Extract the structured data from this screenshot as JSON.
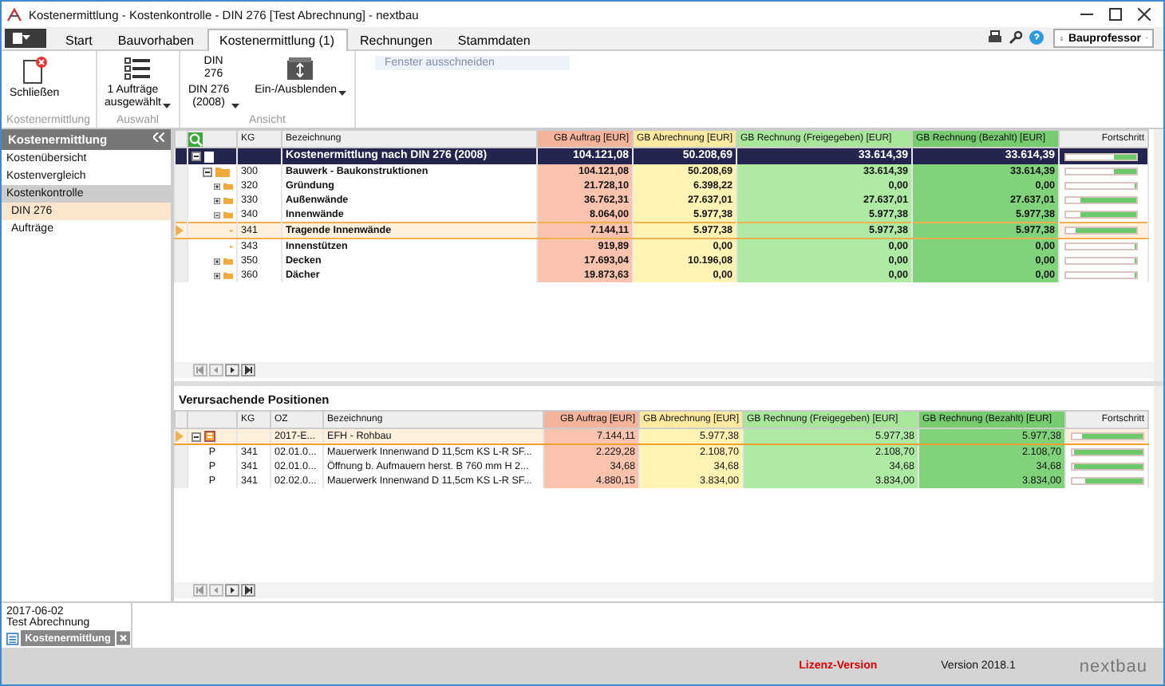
{
  "window": {
    "title": "Kostenermittlung - Kostenkontrolle - DIN 276 [Test Abrechnung] - nextbau"
  },
  "tabs": [
    {
      "label": "Start",
      "selected": false
    },
    {
      "label": "Bauvorhaben",
      "selected": false
    },
    {
      "label": "Kostenermittlung (1)",
      "selected": true
    },
    {
      "label": "Rechnungen",
      "selected": false
    },
    {
      "label": "Stammdaten",
      "selected": false
    }
  ],
  "user": {
    "name": "Bauprofessor"
  },
  "faded_hint": "Fenster ausschneiden",
  "ribbon": [
    {
      "label": "Kostenermittlung",
      "buttons": [
        {
          "kind": "close",
          "label": "Schließen",
          "dropdown": false
        }
      ]
    },
    {
      "label": "Auswahl",
      "buttons": [
        {
          "kind": "list",
          "label": "1 Aufträge\nausgewählt",
          "dropdown": true
        }
      ]
    },
    {
      "label": "Ansicht",
      "buttons": [
        {
          "kind": "text",
          "icon_text": "DIN\n276",
          "label": "DIN 276\n(2008)",
          "dropdown": true
        },
        {
          "kind": "box",
          "label": "Ein-/Ausblenden",
          "dropdown": true
        }
      ]
    }
  ],
  "sidebar": {
    "title": "Kostenermittlung",
    "items": [
      {
        "label": "Kostenübersicht",
        "selected": false
      },
      {
        "label": "Kostenvergleich",
        "selected": false
      },
      {
        "label": "Kostenkontrolle",
        "selected": false,
        "children": [
          {
            "label": "DIN 276",
            "selected": true
          },
          {
            "label": "Aufträge",
            "selected": false
          }
        ]
      }
    ]
  },
  "table": {
    "columns": [
      "KG",
      "Bezeichnung",
      "GB Auftrag [EUR]",
      "GB Abrechnung [EUR]",
      "GB Rechnung (Freigegeben) [EUR]",
      "GB Rechnung (Bezahlt) [EUR]",
      "Fortschritt"
    ],
    "rows": [
      {
        "kg": "",
        "name": "Kostenermittlung nach DIN 276 (2008)",
        "auftrag": "104.121,08",
        "abrechnung": "50.208,69",
        "freigegeben": "33.614,39",
        "bezahlt": "33.614,39",
        "level": 0.3,
        "selected": false,
        "expanded": true,
        "children": [
          {
            "kg": "300",
            "name": "Bauwerk - Baukonstruktionen",
            "auftrag": "104.121,08",
            "abrechnung": "50.208,69",
            "freigegeben": "33.614,39",
            "bezahlt": "33.614,39",
            "level": 0.3,
            "selected": false,
            "expanded": true,
            "children": [
              {
                "kg": "320",
                "name": "Gründung",
                "auftrag": "21.728,10",
                "abrechnung": "6.398,22",
                "freigegeben": "0,00",
                "bezahlt": "0,00",
                "level": 0,
                "selected": false,
                "expanded": false
              },
              {
                "kg": "330",
                "name": "Außenwände",
                "auftrag": "36.762,31",
                "abrechnung": "27.637,01",
                "freigegeben": "27.637,01",
                "bezahlt": "27.637,01",
                "level": 0.78,
                "selected": false,
                "expanded": false
              },
              {
                "kg": "340",
                "name": "Innenwände",
                "auftrag": "8.064,00",
                "abrechnung": "5.977,38",
                "freigegeben": "5.977,38",
                "bezahlt": "5.977,38",
                "level": 0.78,
                "selected": false,
                "expanded": true,
                "children": [
                  {
                    "kg": "341",
                    "name": "Tragende Innenwände",
                    "auftrag": "7.144,11",
                    "abrechnung": "5.977,38",
                    "freigegeben": "5.977,38",
                    "bezahlt": "5.977,38",
                    "level": 0.85,
                    "selected": true
                  },
                  {
                    "kg": "343",
                    "name": "Innenstützen",
                    "auftrag": "919,89",
                    "abrechnung": "0,00",
                    "freigegeben": "0,00",
                    "bezahlt": "0,00",
                    "level": 0,
                    "selected": false
                  }
                ]
              },
              {
                "kg": "350",
                "name": "Decken",
                "auftrag": "17.693,04",
                "abrechnung": "10.196,08",
                "freigegeben": "0,00",
                "bezahlt": "0,00",
                "level": 0,
                "selected": false,
                "expanded": false
              },
              {
                "kg": "360",
                "name": "Dächer",
                "auftrag": "19.873,63",
                "abrechnung": "0,00",
                "freigegeben": "0,00",
                "bezahlt": "0,00",
                "level": 0,
                "selected": false,
                "expanded": false
              }
            ]
          }
        ]
      }
    ]
  },
  "positions": {
    "title": "Verursachende Positionen",
    "columns": [
      "KG",
      "OZ",
      "Bezeichnung",
      "GB Auftrag [EUR]",
      "GB Abrechnung [EUR]",
      "GB Rechnung (Freigegeben) [EUR]",
      "GB Rechnung (Bezahlt) [EUR]",
      "Fortschritt"
    ],
    "rows": [
      {
        "kind": "order",
        "type": "",
        "kg": "",
        "oz": "2017-E...",
        "name": "EFH - Rohbau",
        "auftrag": "7.144,11",
        "abrechnung": "5.977,38",
        "freigegeben": "5.977,38",
        "bezahlt": "5.977,38",
        "level": 0.85,
        "selected": true,
        "expanded": true
      },
      {
        "kind": "position",
        "type": "P",
        "kg": "341",
        "oz": "02.01.0...",
        "name": "Mauerwerk Innenwand D 11,5cm KS L-R SF...",
        "auftrag": "2.229,28",
        "abrechnung": "2.108,70",
        "freigegeben": "2.108,70",
        "bezahlt": "2.108,70",
        "level": 0.95,
        "selected": false
      },
      {
        "kind": "position",
        "type": "P",
        "kg": "341",
        "oz": "02.01.0...",
        "name": "Öffnung b. Aufmauern herst. B 760 mm H 2...",
        "auftrag": "34,68",
        "abrechnung": "34,68",
        "freigegeben": "34,68",
        "bezahlt": "34,68",
        "level": 0.95,
        "selected": false
      },
      {
        "kind": "position",
        "type": "P",
        "kg": "341",
        "oz": "02.02.0...",
        "name": "Mauerwerk Innenwand D 11,5cm KS L-R SF...",
        "auftrag": "4.880,15",
        "abrechnung": "3.834,00",
        "freigegeben": "3.834,00",
        "bezahlt": "3.834,00",
        "level": 0.8,
        "selected": false
      }
    ]
  },
  "task": {
    "date": "2017-06-02",
    "name": "Test Abrechnung",
    "tab": "Kostenermittlung"
  },
  "status_bar": {
    "license": "Lizenz-Version",
    "version": "Version 2018.1",
    "logo": "nextbau"
  }
}
